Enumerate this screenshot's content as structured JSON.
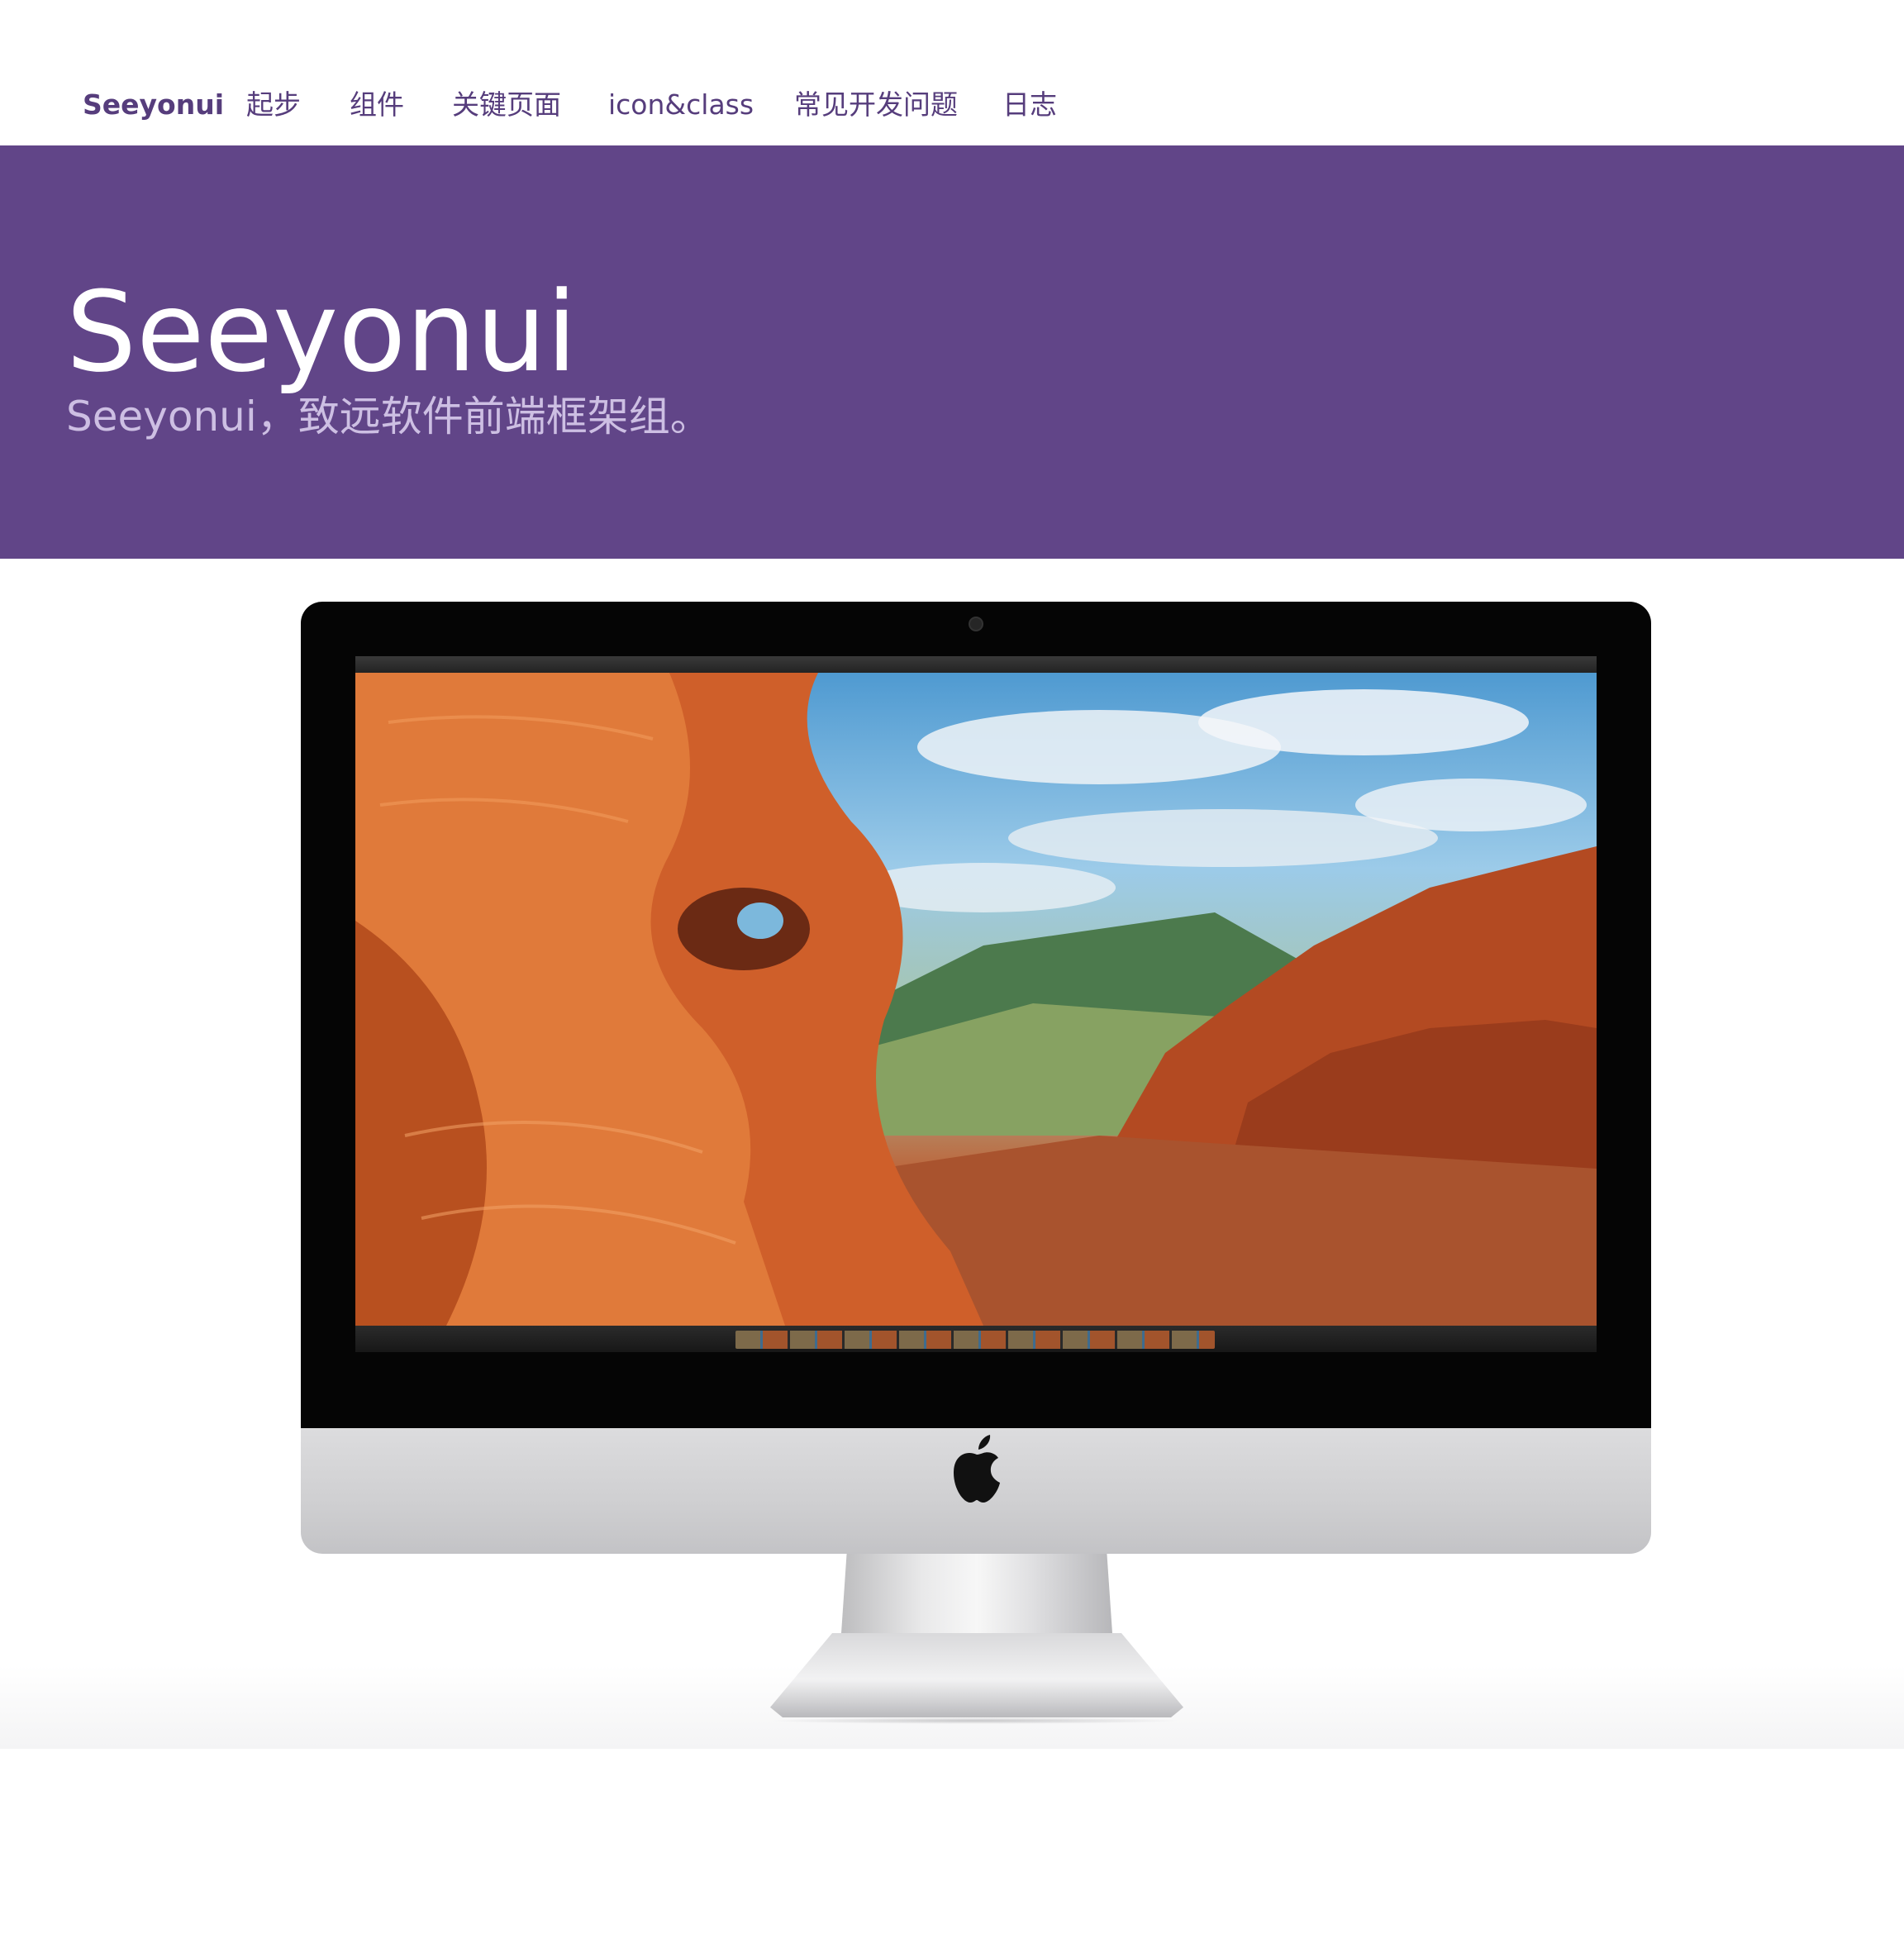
{
  "nav": {
    "brand": "Seeyonui",
    "items": [
      {
        "label": "起步"
      },
      {
        "label": "组件"
      },
      {
        "label": "关键页面"
      },
      {
        "label": "icon&class"
      },
      {
        "label": "常见开发问题"
      },
      {
        "label": "日志"
      }
    ]
  },
  "hero": {
    "title": "Seeyonui",
    "subtitle": "Seeyonui，致远软件前端框架组。"
  },
  "colors": {
    "brand_purple": "#614588",
    "nav_text": "#563d7c",
    "hero_subtitle": "#cdbfe3"
  },
  "showcase": {
    "device_icon": "apple-logo-icon"
  }
}
